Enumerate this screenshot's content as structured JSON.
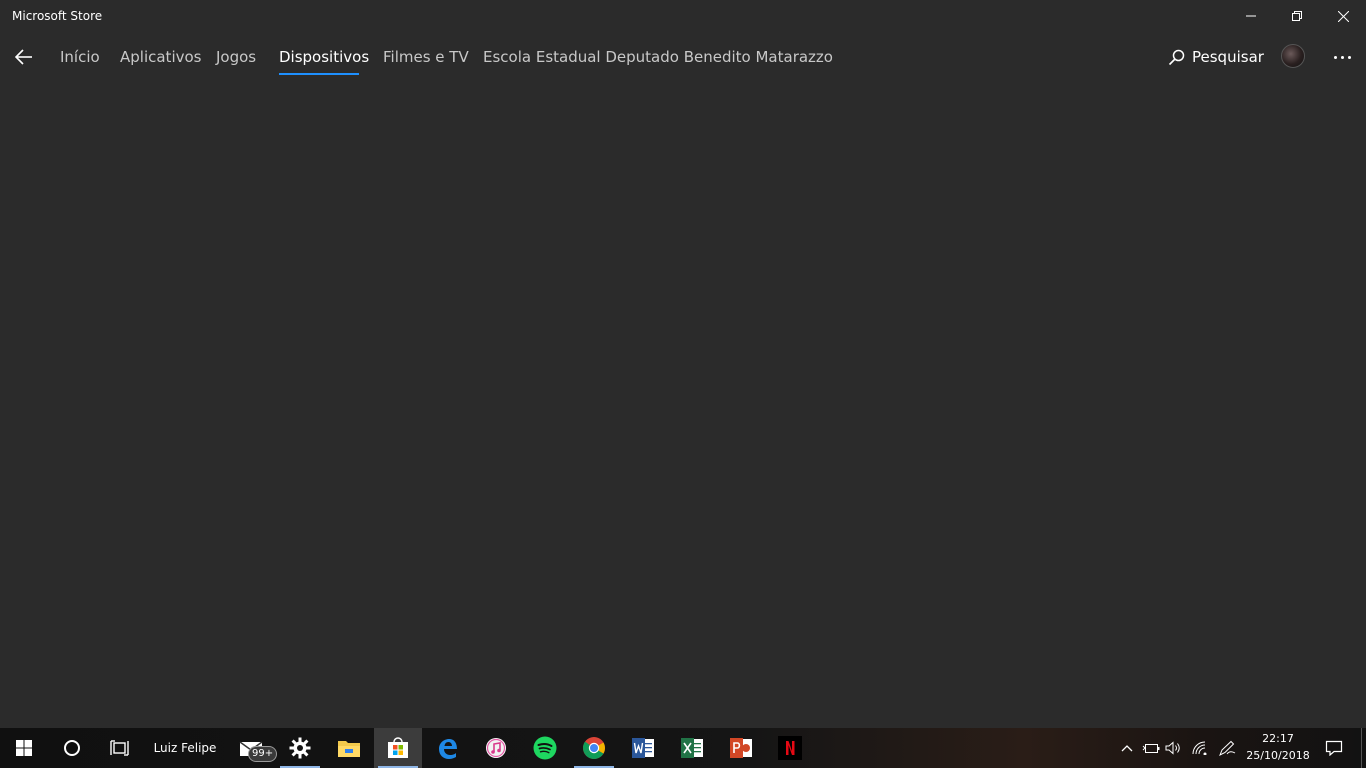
{
  "window": {
    "title": "Microsoft Store"
  },
  "nav": {
    "tabs": [
      {
        "label": "Início"
      },
      {
        "label": "Aplicativos"
      },
      {
        "label": "Jogos"
      },
      {
        "label": "Dispositivos",
        "active": true
      },
      {
        "label": "Filmes e TV"
      },
      {
        "label": "Escola Estadual Deputado Benedito Matarazzo"
      }
    ],
    "search_label": "Pesquisar"
  },
  "taskbar": {
    "user_name": "Luiz Felipe",
    "mail_badge": "99+",
    "apps": [
      "mail-icon",
      "settings-icon",
      "file-explorer-icon",
      "microsoft-store-icon",
      "edge-icon",
      "itunes-icon",
      "spotify-icon",
      "chrome-icon",
      "word-icon",
      "excel-icon",
      "powerpoint-icon",
      "netflix-icon"
    ],
    "clock": {
      "time": "22:17",
      "date": "25/10/2018"
    }
  },
  "colors": {
    "background": "#2b2b2b",
    "accent": "#1e90ff"
  }
}
